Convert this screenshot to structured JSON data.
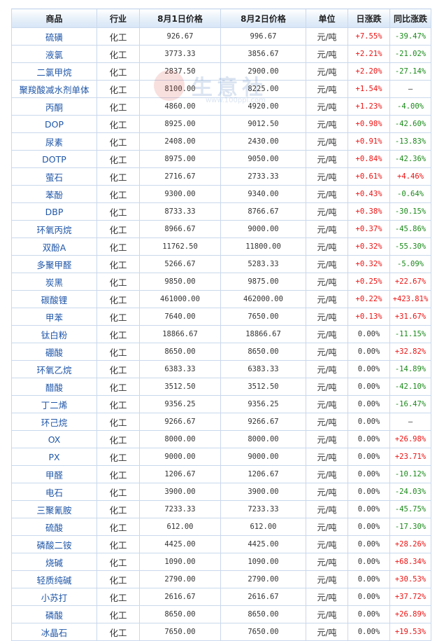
{
  "header": {
    "name": "商品",
    "industry": "行业",
    "price1": "8月1日价格",
    "price2": "8月2日价格",
    "unit": "单位",
    "day_change": "日涨跌",
    "yoy_change": "同比涨跌"
  },
  "watermark": {
    "text": "生意社",
    "url": "www.100ppi.com"
  },
  "colors": {
    "up": "#ee1111",
    "down": "#1a8a1a",
    "link": "#1f56a8",
    "border": "#c9d8ec"
  },
  "rows": [
    {
      "name": "硫磺",
      "industry": "化工",
      "price1": "926.67",
      "price2": "996.67",
      "unit": "元/吨",
      "day": "+7.55%",
      "yoy": "-39.47%"
    },
    {
      "name": "液氯",
      "industry": "化工",
      "price1": "3773.33",
      "price2": "3856.67",
      "unit": "元/吨",
      "day": "+2.21%",
      "yoy": "-21.02%"
    },
    {
      "name": "二氯甲烷",
      "industry": "化工",
      "price1": "2837.50",
      "price2": "2900.00",
      "unit": "元/吨",
      "day": "+2.20%",
      "yoy": "-27.14%"
    },
    {
      "name": "聚羧酸减水剂单体",
      "industry": "化工",
      "price1": "8100.00",
      "price2": "8225.00",
      "unit": "元/吨",
      "day": "+1.54%",
      "yoy": "—"
    },
    {
      "name": "丙酮",
      "industry": "化工",
      "price1": "4860.00",
      "price2": "4920.00",
      "unit": "元/吨",
      "day": "+1.23%",
      "yoy": "-4.00%"
    },
    {
      "name": "DOP",
      "industry": "化工",
      "price1": "8925.00",
      "price2": "9012.50",
      "unit": "元/吨",
      "day": "+0.98%",
      "yoy": "-42.60%"
    },
    {
      "name": "尿素",
      "industry": "化工",
      "price1": "2408.00",
      "price2": "2430.00",
      "unit": "元/吨",
      "day": "+0.91%",
      "yoy": "-13.83%"
    },
    {
      "name": "DOTP",
      "industry": "化工",
      "price1": "8975.00",
      "price2": "9050.00",
      "unit": "元/吨",
      "day": "+0.84%",
      "yoy": "-42.36%"
    },
    {
      "name": "萤石",
      "industry": "化工",
      "price1": "2716.67",
      "price2": "2733.33",
      "unit": "元/吨",
      "day": "+0.61%",
      "yoy": "+4.46%"
    },
    {
      "name": "苯酚",
      "industry": "化工",
      "price1": "9300.00",
      "price2": "9340.00",
      "unit": "元/吨",
      "day": "+0.43%",
      "yoy": "-0.64%"
    },
    {
      "name": "DBP",
      "industry": "化工",
      "price1": "8733.33",
      "price2": "8766.67",
      "unit": "元/吨",
      "day": "+0.38%",
      "yoy": "-30.15%"
    },
    {
      "name": "环氧丙烷",
      "industry": "化工",
      "price1": "8966.67",
      "price2": "9000.00",
      "unit": "元/吨",
      "day": "+0.37%",
      "yoy": "-45.86%"
    },
    {
      "name": "双酚A",
      "industry": "化工",
      "price1": "11762.50",
      "price2": "11800.00",
      "unit": "元/吨",
      "day": "+0.32%",
      "yoy": "-55.30%"
    },
    {
      "name": "多聚甲醛",
      "industry": "化工",
      "price1": "5266.67",
      "price2": "5283.33",
      "unit": "元/吨",
      "day": "+0.32%",
      "yoy": "-5.09%"
    },
    {
      "name": "炭黑",
      "industry": "化工",
      "price1": "9850.00",
      "price2": "9875.00",
      "unit": "元/吨",
      "day": "+0.25%",
      "yoy": "+22.67%"
    },
    {
      "name": "碳酸锂",
      "industry": "化工",
      "price1": "461000.00",
      "price2": "462000.00",
      "unit": "元/吨",
      "day": "+0.22%",
      "yoy": "+423.81%"
    },
    {
      "name": "甲苯",
      "industry": "化工",
      "price1": "7640.00",
      "price2": "7650.00",
      "unit": "元/吨",
      "day": "+0.13%",
      "yoy": "+31.67%"
    },
    {
      "name": "钛白粉",
      "industry": "化工",
      "price1": "18866.67",
      "price2": "18866.67",
      "unit": "元/吨",
      "day": "0.00%",
      "yoy": "-11.15%"
    },
    {
      "name": "硼酸",
      "industry": "化工",
      "price1": "8650.00",
      "price2": "8650.00",
      "unit": "元/吨",
      "day": "0.00%",
      "yoy": "+32.82%"
    },
    {
      "name": "环氧乙烷",
      "industry": "化工",
      "price1": "6383.33",
      "price2": "6383.33",
      "unit": "元/吨",
      "day": "0.00%",
      "yoy": "-14.89%"
    },
    {
      "name": "醋酸",
      "industry": "化工",
      "price1": "3512.50",
      "price2": "3512.50",
      "unit": "元/吨",
      "day": "0.00%",
      "yoy": "-42.10%"
    },
    {
      "name": "丁二烯",
      "industry": "化工",
      "price1": "9356.25",
      "price2": "9356.25",
      "unit": "元/吨",
      "day": "0.00%",
      "yoy": "-16.47%"
    },
    {
      "name": "环己烷",
      "industry": "化工",
      "price1": "9266.67",
      "price2": "9266.67",
      "unit": "元/吨",
      "day": "0.00%",
      "yoy": "—"
    },
    {
      "name": "OX",
      "industry": "化工",
      "price1": "8000.00",
      "price2": "8000.00",
      "unit": "元/吨",
      "day": "0.00%",
      "yoy": "+26.98%"
    },
    {
      "name": "PX",
      "industry": "化工",
      "price1": "9000.00",
      "price2": "9000.00",
      "unit": "元/吨",
      "day": "0.00%",
      "yoy": "+23.71%"
    },
    {
      "name": "甲醛",
      "industry": "化工",
      "price1": "1206.67",
      "price2": "1206.67",
      "unit": "元/吨",
      "day": "0.00%",
      "yoy": "-10.12%"
    },
    {
      "name": "电石",
      "industry": "化工",
      "price1": "3900.00",
      "price2": "3900.00",
      "unit": "元/吨",
      "day": "0.00%",
      "yoy": "-24.03%"
    },
    {
      "name": "三聚氰胺",
      "industry": "化工",
      "price1": "7233.33",
      "price2": "7233.33",
      "unit": "元/吨",
      "day": "0.00%",
      "yoy": "-45.75%"
    },
    {
      "name": "硫酸",
      "industry": "化工",
      "price1": "612.00",
      "price2": "612.00",
      "unit": "元/吨",
      "day": "0.00%",
      "yoy": "-17.30%"
    },
    {
      "name": "磷酸二铵",
      "industry": "化工",
      "price1": "4425.00",
      "price2": "4425.00",
      "unit": "元/吨",
      "day": "0.00%",
      "yoy": "+28.26%"
    },
    {
      "name": "烧碱",
      "industry": "化工",
      "price1": "1090.00",
      "price2": "1090.00",
      "unit": "元/吨",
      "day": "0.00%",
      "yoy": "+68.34%"
    },
    {
      "name": "轻质纯碱",
      "industry": "化工",
      "price1": "2790.00",
      "price2": "2790.00",
      "unit": "元/吨",
      "day": "0.00%",
      "yoy": "+30.53%"
    },
    {
      "name": "小苏打",
      "industry": "化工",
      "price1": "2616.67",
      "price2": "2616.67",
      "unit": "元/吨",
      "day": "0.00%",
      "yoy": "+37.72%"
    },
    {
      "name": "磷酸",
      "industry": "化工",
      "price1": "8650.00",
      "price2": "8650.00",
      "unit": "元/吨",
      "day": "0.00%",
      "yoy": "+26.89%"
    },
    {
      "name": "冰晶石",
      "industry": "化工",
      "price1": "7650.00",
      "price2": "7650.00",
      "unit": "元/吨",
      "day": "0.00%",
      "yoy": "+19.53%"
    }
  ]
}
